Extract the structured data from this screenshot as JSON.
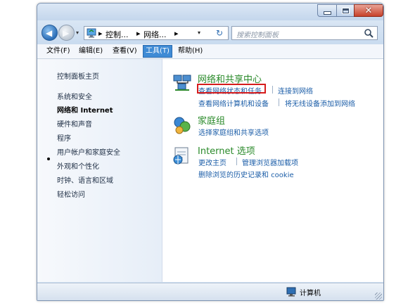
{
  "window": {
    "controls": {
      "minimize_icon": "minimize-icon",
      "maximize_icon": "maximize-icon",
      "close_icon": "close-icon",
      "close_glyph": "✕"
    }
  },
  "nav": {
    "back_arrow": "◀",
    "forward_arrow": "▶",
    "breadcrumb": [
      "控制...",
      "网络...",
      ""
    ],
    "separators": [
      "▸",
      "▸",
      "▸"
    ],
    "dropdown_glyph": "▾",
    "refresh_glyph": "↻",
    "search_placeholder": "搜索控制面板"
  },
  "menubar": {
    "items": [
      "文件(F)",
      "编辑(E)",
      "查看(V)",
      "工具(T)",
      "帮助(H)"
    ],
    "active_index": 3
  },
  "sidebar": {
    "items": [
      "控制面板主页",
      "系统和安全",
      "网络和 Internet",
      "硬件和声音",
      "程序",
      "用户帐户和家庭安全",
      "外观和个性化",
      "时钟、语言和区域",
      "轻松访问"
    ],
    "current_index": 2
  },
  "categories": [
    {
      "title": "网络和共享中心",
      "icon": "network-sharing-icon",
      "links": [
        "查看网络状态和任务",
        "连接到网络",
        "查看网络计算机和设备",
        "将无线设备添加到网络"
      ],
      "highlighted_link": "查看网络状态和任务"
    },
    {
      "title": "家庭组",
      "icon": "homegroup-icon",
      "links": [
        "选择家庭组和共享选项"
      ]
    },
    {
      "title": "Internet 选项",
      "icon": "internet-options-icon",
      "links": [
        "更改主页",
        "管理浏览器加载项",
        "删除浏览的历史记录和 cookie"
      ]
    }
  ],
  "statusbar": {
    "text": "计算机",
    "icon": "computer-icon"
  },
  "colors": {
    "highlight_border": "#d61c1c",
    "link": "#1c5ea8",
    "category_title": "#2a8a2a",
    "active_menu": "#3f8bd5"
  }
}
